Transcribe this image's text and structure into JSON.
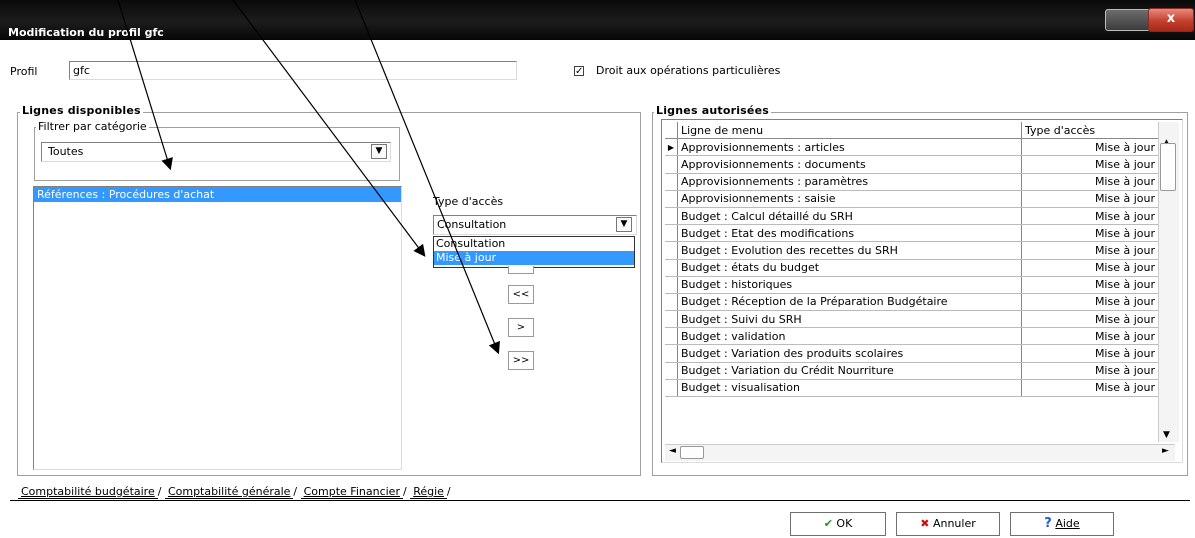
{
  "window": {
    "title": "Modification du profil gfc",
    "close_glyph": "x"
  },
  "profil": {
    "label": "Profil",
    "value": "gfc"
  },
  "droit": {
    "label": "Droit aux opérations particulières",
    "checked": true,
    "glyph": "✓"
  },
  "lignes_disponibles": {
    "title": "Lignes disponibles",
    "filter": {
      "label": "Filtrer par catégorie",
      "value": "Toutes",
      "arrow": "▼"
    },
    "items": [
      "Références : Procédures d'achat"
    ]
  },
  "type_acces": {
    "label": "Type d'accès",
    "value": "Consultation",
    "arrow": "▼",
    "options": [
      "Consultation",
      "Mise à jour"
    ],
    "highlighted": "Mise à jour"
  },
  "move_buttons": {
    "remove_all": "<<",
    "add": ">",
    "add_all": ">>"
  },
  "lignes_autorisees": {
    "title": "Lignes autorisées",
    "columns": [
      "Ligne de menu",
      "Type d'accès"
    ],
    "current_marker": "▶",
    "rows": [
      {
        "ligne": "Approvisionnements : articles",
        "type": "Mise à jour"
      },
      {
        "ligne": "Approvisionnements : documents",
        "type": "Mise à jour"
      },
      {
        "ligne": "Approvisionnements : paramètres",
        "type": "Mise à jour"
      },
      {
        "ligne": "Approvisionnements : saisie",
        "type": "Mise à jour"
      },
      {
        "ligne": "Budget : Calcul détaillé du SRH",
        "type": "Mise à jour"
      },
      {
        "ligne": "Budget : Etat des modifications",
        "type": "Mise à jour"
      },
      {
        "ligne": "Budget : Evolution des recettes du SRH",
        "type": "Mise à jour"
      },
      {
        "ligne": "Budget : états du budget",
        "type": "Mise à jour"
      },
      {
        "ligne": "Budget : historiques",
        "type": "Mise à jour"
      },
      {
        "ligne": "Budget : Réception de la Préparation Budgétaire",
        "type": "Mise à jour"
      },
      {
        "ligne": "Budget : Suivi du SRH",
        "type": "Mise à jour"
      },
      {
        "ligne": "Budget : validation",
        "type": "Mise à jour"
      },
      {
        "ligne": "Budget : Variation des produits scolaires",
        "type": "Mise à jour"
      },
      {
        "ligne": "Budget : Variation du Crédit Nourriture",
        "type": "Mise à jour"
      },
      {
        "ligne": "Budget : visualisation",
        "type": "Mise à jour"
      }
    ],
    "scroll_up": "▲",
    "scroll_down": "▼",
    "scroll_left": "◄",
    "scroll_right": "►"
  },
  "tabs": [
    "Comptabilité budgétaire",
    "Comptabilité générale",
    "Compte Financier",
    "Régie"
  ],
  "footer": {
    "ok": "OK",
    "ok_icon": "✔",
    "annuler": "Annuler",
    "annuler_icon": "✖",
    "aide": "Aide",
    "aide_icon": "?"
  },
  "colors": {
    "selection": "#3399ff",
    "ok_green": "#1a9a1a",
    "cancel_red": "#cc1111",
    "help_blue": "#1e5fd6"
  }
}
